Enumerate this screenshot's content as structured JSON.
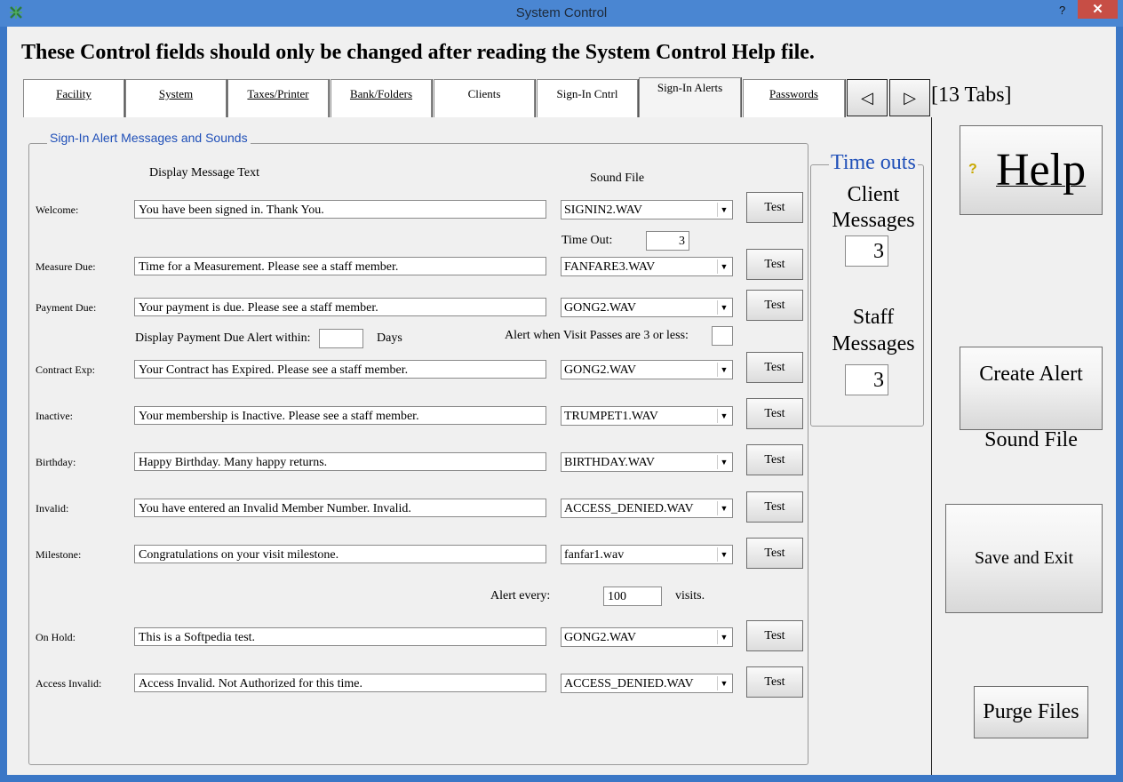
{
  "window": {
    "title": "System Control",
    "help_glyph": "?",
    "close_glyph": "✕"
  },
  "header": "These Control fields should only be changed after reading the System Control Help file.",
  "tabs": [
    "Facility",
    "System",
    "Taxes/Printer",
    "Bank/Folders",
    "Clients",
    "Sign-In Cntrl",
    "Sign-In Alerts",
    "Passwords"
  ],
  "active_tab": "Sign-In Alerts",
  "tab_nav": {
    "prev": "◁",
    "next": "▷",
    "count_label": "[13 Tabs]"
  },
  "group": {
    "title": "Sign-In Alert Messages and Sounds",
    "col_message": "Display Message Text",
    "col_sound": "Sound File",
    "test_label": "Test",
    "rows": [
      {
        "label": "Welcome:",
        "message": "You have been signed in.  Thank You.",
        "sound": "SIGNIN2.WAV"
      },
      {
        "label": "Measure Due:",
        "message": "Time for a Measurement. Please see a staff member.",
        "sound": "FANFARE3.WAV"
      },
      {
        "label": "Payment Due:",
        "message": "Your payment is due. Please see a staff member.",
        "sound": "GONG2.WAV"
      },
      {
        "label": "Contract Exp:",
        "message": "Your Contract has Expired. Please see a staff member.",
        "sound": "GONG2.WAV"
      },
      {
        "label": "Inactive:",
        "message": "Your membership is Inactive. Please see a staff member.",
        "sound": "TRUMPET1.WAV"
      },
      {
        "label": "Birthday:",
        "message": "Happy Birthday.  Many happy returns.",
        "sound": "BIRTHDAY.WAV"
      },
      {
        "label": "Invalid:",
        "message": "You have entered an Invalid Member Number. Invalid.",
        "sound": "ACCESS_DENIED.WAV"
      },
      {
        "label": "Milestone:",
        "message": "Congratulations on your visit milestone.",
        "sound": "fanfar1.wav"
      },
      {
        "label": "On Hold:",
        "message": "This is a Softpedia test.",
        "sound": "GONG2.WAV"
      },
      {
        "label": "Access Invalid:",
        "message": "Access Invalid.  Not Authorized for this time.",
        "sound": "ACCESS_DENIED.WAV"
      }
    ],
    "timeout_label": "Time Out:",
    "timeout_value": "3",
    "payment_alert_label": "Display Payment Due Alert within:",
    "payment_alert_value": "",
    "payment_alert_unit": "Days",
    "visit_passes_label": "Alert when Visit Passes are 3 or less:",
    "alert_every_label": "Alert every:",
    "alert_every_value": "100",
    "alert_every_unit": "visits."
  },
  "timeouts": {
    "title": "Time outs",
    "client_label_1": "Client",
    "client_label_2": "Messages",
    "client_value": "3",
    "staff_label_1": "Staff",
    "staff_label_2": "Messages",
    "staff_value": "3"
  },
  "buttons": {
    "help": "Help",
    "help_icon": "?",
    "create_alert_1": "Create Alert",
    "create_alert_2": "Sound File",
    "save_exit": "Save and Exit",
    "purge": "Purge Files"
  }
}
